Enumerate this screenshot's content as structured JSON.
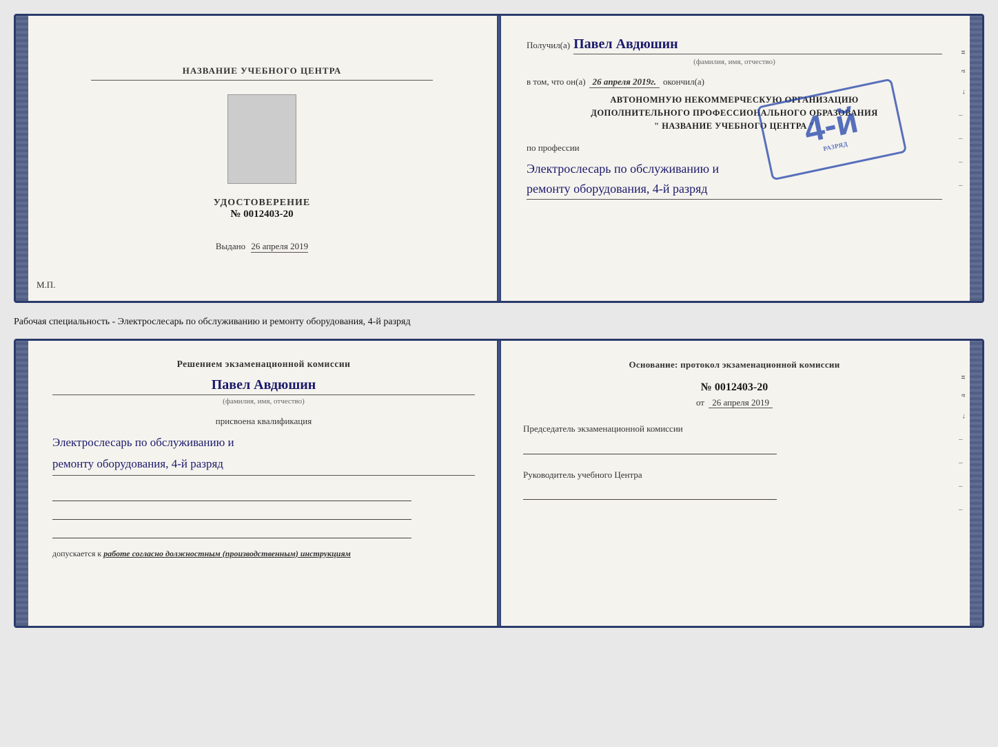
{
  "doc_top": {
    "left": {
      "training_center": "НАЗВАНИЕ УЧЕБНОГО ЦЕНТРА",
      "cert_label": "УДОСТОВЕРЕНИЕ",
      "cert_number": "№ 0012403-20",
      "vydano_label": "Выдано",
      "vydano_date": "26 апреля 2019",
      "mp_label": "М.П."
    },
    "right": {
      "poluchil_label": "Получил(а)",
      "recipient_name": "Павел Авдюшин",
      "fio_hint": "(фамилия, имя, отчество)",
      "vtom_label": "в том, что он(а)",
      "vtom_date": "26 апреля 2019г.",
      "okonchil_label": "окончил(а)",
      "org_line1": "АВТОНОМНУЮ НЕКОММЕРЧЕСКУЮ ОРГАНИЗАЦИЮ",
      "org_line2": "ДОПОЛНИТЕЛЬНОГО ПРОФЕССИОНАЛЬНОГО ОБРАЗОВАНИЯ",
      "org_line3": "\" НАЗВАНИЕ УЧЕБНОГО ЦЕНТРА \"",
      "po_professii_label": "по профессии",
      "profession_line1": "Электрослесарь по обслуживанию и",
      "profession_line2": "ремонту оборудования, 4-й разряд",
      "stamp_grade": "4-й",
      "stamp_line1": "разряд"
    }
  },
  "between": {
    "text": "Рабочая специальность - Электрослесарь по обслуживанию и ремонту оборудования, 4-й разряд"
  },
  "doc_bottom": {
    "left": {
      "resolution_title": "Решением экзаменационной комиссии",
      "name": "Павел Авдюшин",
      "fio_hint": "(фамилия, имя, отчество)",
      "prisvoena_label": "присвоена квалификация",
      "qualification_line1": "Электрослесарь по обслуживанию и",
      "qualification_line2": "ремонту оборудования, 4-й разряд",
      "dopuskaetsya_label": "допускается к",
      "dopuskaetsya_val": "работе согласно должностным (производственным) инструкциям"
    },
    "right": {
      "osnovaniye_label": "Основание: протокол экзаменационной комиссии",
      "protocol_number": "№ 0012403-20",
      "ot_label": "от",
      "ot_date": "26 апреля 2019",
      "predsedatel_label": "Председатель экзаменационной комиссии",
      "rukovoditel_label": "Руководитель учебного Центра"
    }
  },
  "right_edge": {
    "items": [
      "и",
      "а",
      "←",
      "–",
      "–",
      "–",
      "–",
      "–"
    ]
  }
}
